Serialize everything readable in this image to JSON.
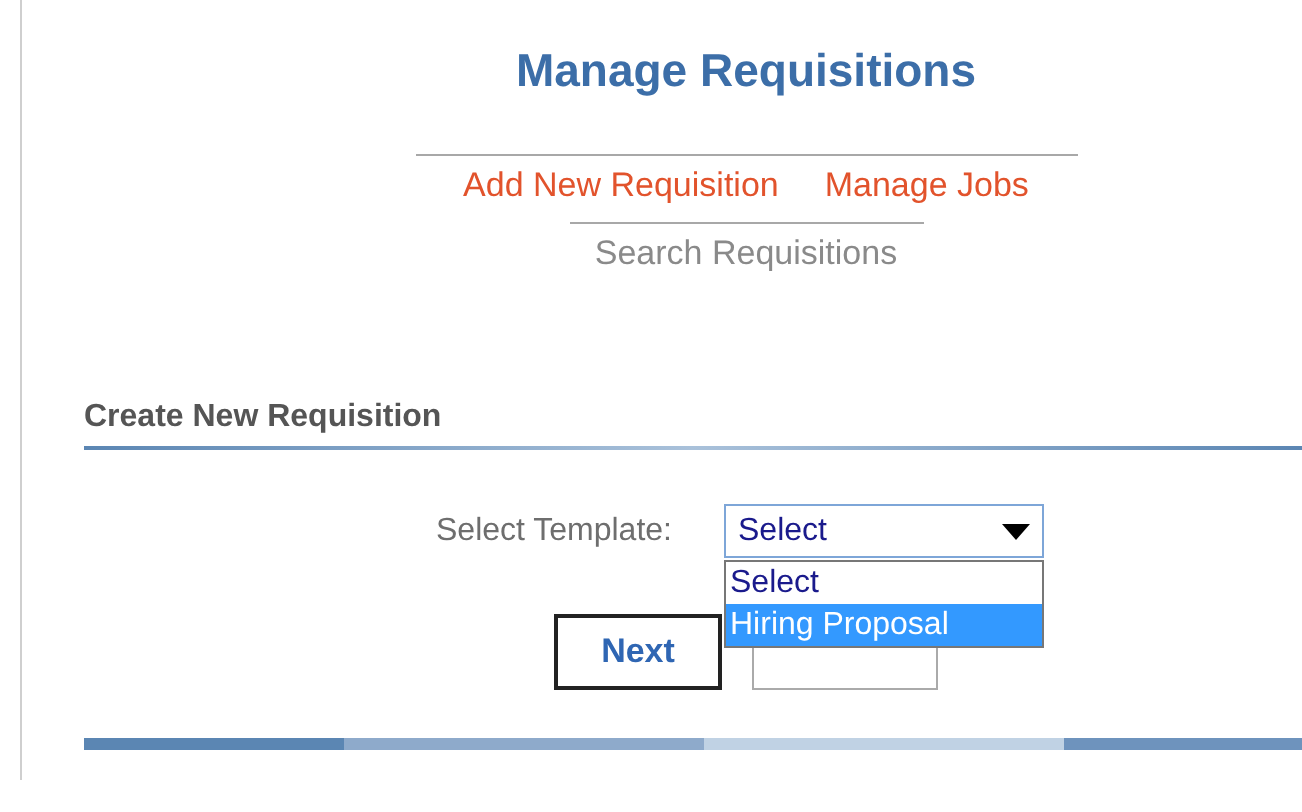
{
  "title": "Manage Requisitions",
  "nav_links": [
    {
      "label": "Add New Requisition"
    },
    {
      "label": "Manage Jobs"
    }
  ],
  "secondary_link": "Search Requisitions",
  "section": {
    "title": "Create New Requisition",
    "template_select": {
      "label": "Select Template:",
      "value": "Select",
      "expanded": true,
      "options": [
        {
          "label": "Select",
          "highlighted": false
        },
        {
          "label": "Hiring Proposal",
          "highlighted": true
        }
      ]
    },
    "buttons": [
      {
        "label": "Next",
        "focused": true
      },
      {
        "focused": false
      }
    ]
  }
}
